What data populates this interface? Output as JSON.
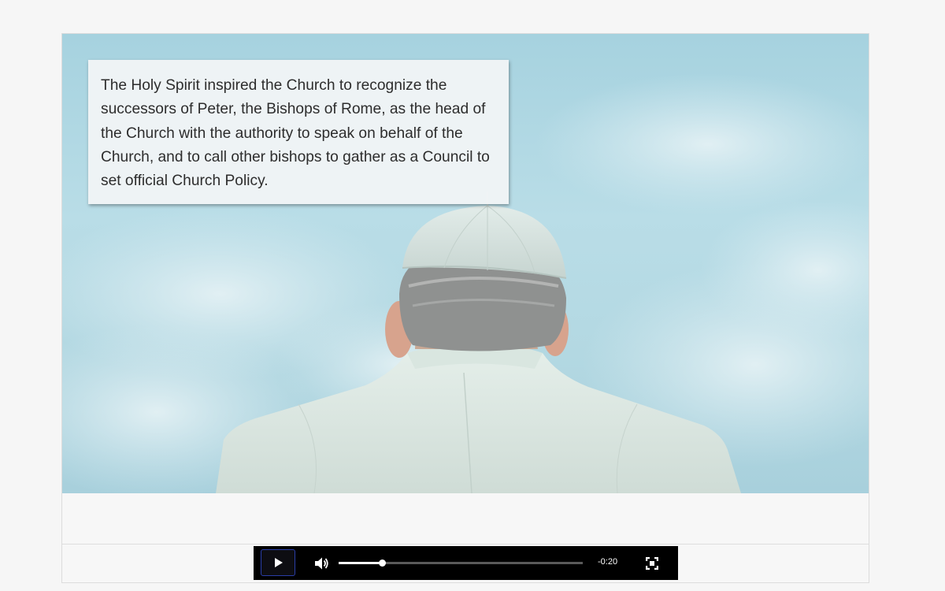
{
  "slide": {
    "caption": "The Holy Spirit inspired the Church to recognize the successors of Peter, the Bishops of Rome, as the head of the Church with the authority to speak on behalf of the Church, and to call other bishops to gather as a Council to set official Church Policy.",
    "image_subject": "pope seen from behind against cloudy sky"
  },
  "player": {
    "time_remaining": "-0:20",
    "progress_fraction": 0.18,
    "icons": {
      "play": "play-icon",
      "volume": "volume-icon",
      "fullscreen": "fullscreen-icon"
    }
  },
  "colors": {
    "page_background": "#f6f6f6",
    "player_background": "#000000",
    "play_button_border": "#2a3ea8",
    "sky": "#b3d8e2"
  }
}
